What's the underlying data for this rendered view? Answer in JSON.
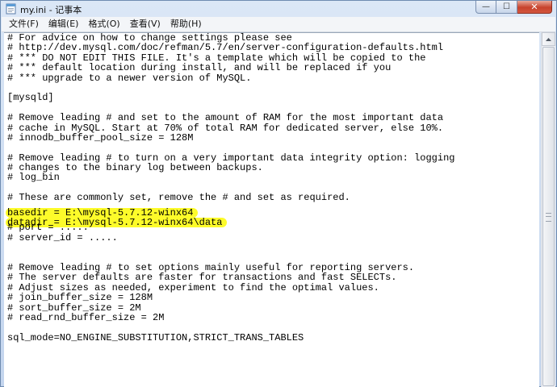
{
  "window": {
    "title": "my.ini - 记事本",
    "minimize_glyph": "—",
    "maximize_glyph": "☐",
    "close_glyph": "✕"
  },
  "menu": [
    {
      "label": "文件(F)"
    },
    {
      "label": "编辑(E)"
    },
    {
      "label": "格式(O)"
    },
    {
      "label": "查看(V)"
    },
    {
      "label": "帮助(H)"
    }
  ],
  "editor": {
    "highlight_color": "#fdfb2a",
    "lines": [
      "# For advice on how to change settings please see",
      "# http://dev.mysql.com/doc/refman/5.7/en/server-configuration-defaults.html",
      "# *** DO NOT EDIT THIS FILE. It's a template which will be copied to the",
      "# *** default location during install, and will be replaced if you",
      "# *** upgrade to a newer version of MySQL.",
      "",
      "[mysqld]",
      "",
      "# Remove leading # and set to the amount of RAM for the most important data",
      "# cache in MySQL. Start at 70% of total RAM for dedicated server, else 10%.",
      "# innodb_buffer_pool_size = 128M",
      "",
      "# Remove leading # to turn on a very important data integrity option: logging",
      "# changes to the binary log between backups.",
      "# log_bin",
      "",
      "# These are commonly set, remove the # and set as required.",
      "basedir = E:\\mysql-5.7.12-winx64",
      "datadir = E:\\mysql-5.7.12-winx64\\data",
      "# port = .....",
      "# server_id = .....",
      "",
      "",
      "# Remove leading # to set options mainly useful for reporting servers.",
      "# The server defaults are faster for transactions and fast SELECTs.",
      "# Adjust sizes as needed, experiment to find the optimal values.",
      "# join_buffer_size = 128M",
      "# sort_buffer_size = 2M",
      "# read_rnd_buffer_size = 2M",
      "",
      "sql_mode=NO_ENGINE_SUBSTITUTION,STRICT_TRANS_TABLES"
    ],
    "highlighted_lines": [
      17,
      18
    ]
  }
}
